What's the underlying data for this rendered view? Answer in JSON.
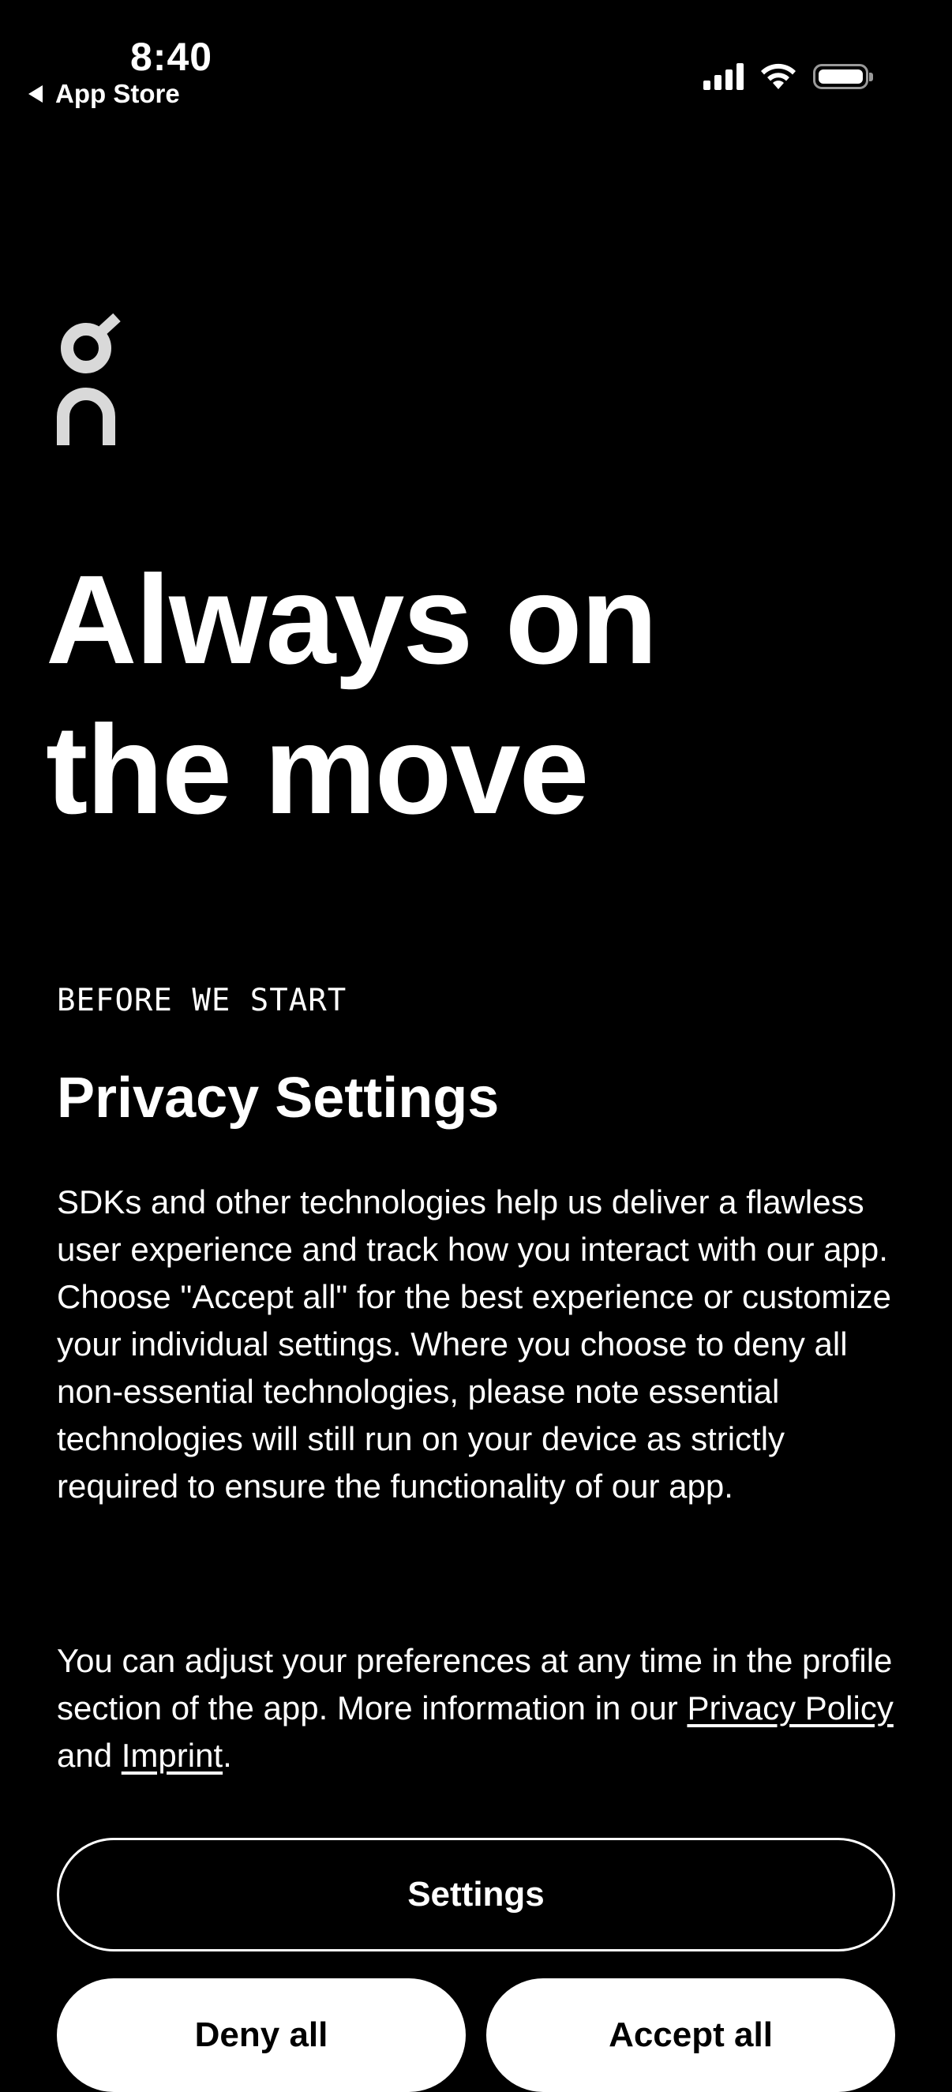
{
  "status_bar": {
    "time": "8:40",
    "back_label": "App Store",
    "icons": [
      "back-arrow-icon",
      "cellular-signal-icon",
      "wifi-icon",
      "battery-icon"
    ]
  },
  "brand": {
    "logo_icon": "on-logo-icon",
    "logo_color": "#d9d9d9"
  },
  "hero": {
    "line1": "Always on",
    "line2": "the move"
  },
  "privacy": {
    "eyebrow": "BEFORE WE START",
    "title": "Privacy Settings",
    "paragraph1": "SDKs and other technologies help us deliver a flawless user experience and track how you interact with our app. Choose \"Accept all\" for the best experience or customize your individual settings. Where you choose to deny all non-essential technologies, please note essential technologies will still run on your device as strictly required to ensure the functionality of our app.",
    "paragraph2_prefix": "You can adjust your preferences at any time in the profile section of the app.  More information in our ",
    "privacy_policy_link": "Privacy Policy",
    "paragraph2_middle": " and ",
    "imprint_link": "Imprint",
    "paragraph2_suffix": "."
  },
  "actions": {
    "settings_label": "Settings",
    "deny_all_label": "Deny all",
    "accept_all_label": "Accept all"
  },
  "colors": {
    "background": "#000000",
    "text": "#ffffff",
    "button_fill": "#ffffff",
    "button_text": "#000000"
  }
}
